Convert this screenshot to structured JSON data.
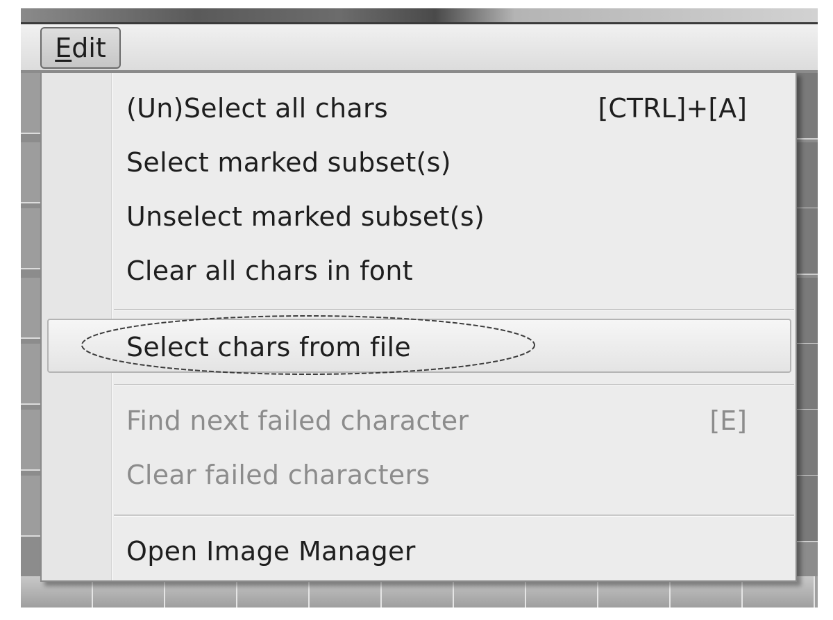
{
  "menubar": {
    "edit_menu": {
      "label_mnemonic": "E",
      "label_rest": "dit"
    }
  },
  "dropdown": {
    "groups": [
      [
        {
          "label": "(Un)Select all chars",
          "shortcut": "[CTRL]+[A]",
          "enabled": true
        },
        {
          "label": "Select marked subset(s)",
          "shortcut": "",
          "enabled": true
        },
        {
          "label": "Unselect marked subset(s)",
          "shortcut": "",
          "enabled": true
        },
        {
          "label": "Clear all chars in font",
          "shortcut": "",
          "enabled": true
        }
      ],
      [
        {
          "label": "Select chars from file",
          "shortcut": "",
          "enabled": true,
          "highlighted": true
        }
      ],
      [
        {
          "label": "Find next failed character",
          "shortcut": "[E]",
          "enabled": false
        },
        {
          "label": "Clear failed characters",
          "shortcut": "",
          "enabled": false
        }
      ],
      [
        {
          "label": "Open Image Manager",
          "shortcut": "",
          "enabled": true
        }
      ]
    ]
  },
  "colors": {
    "menu_background": "#ececec",
    "text_enabled": "#1e1e1e",
    "text_disabled": "#8c8c8c",
    "annotation_stroke": "#3c3c3c"
  }
}
